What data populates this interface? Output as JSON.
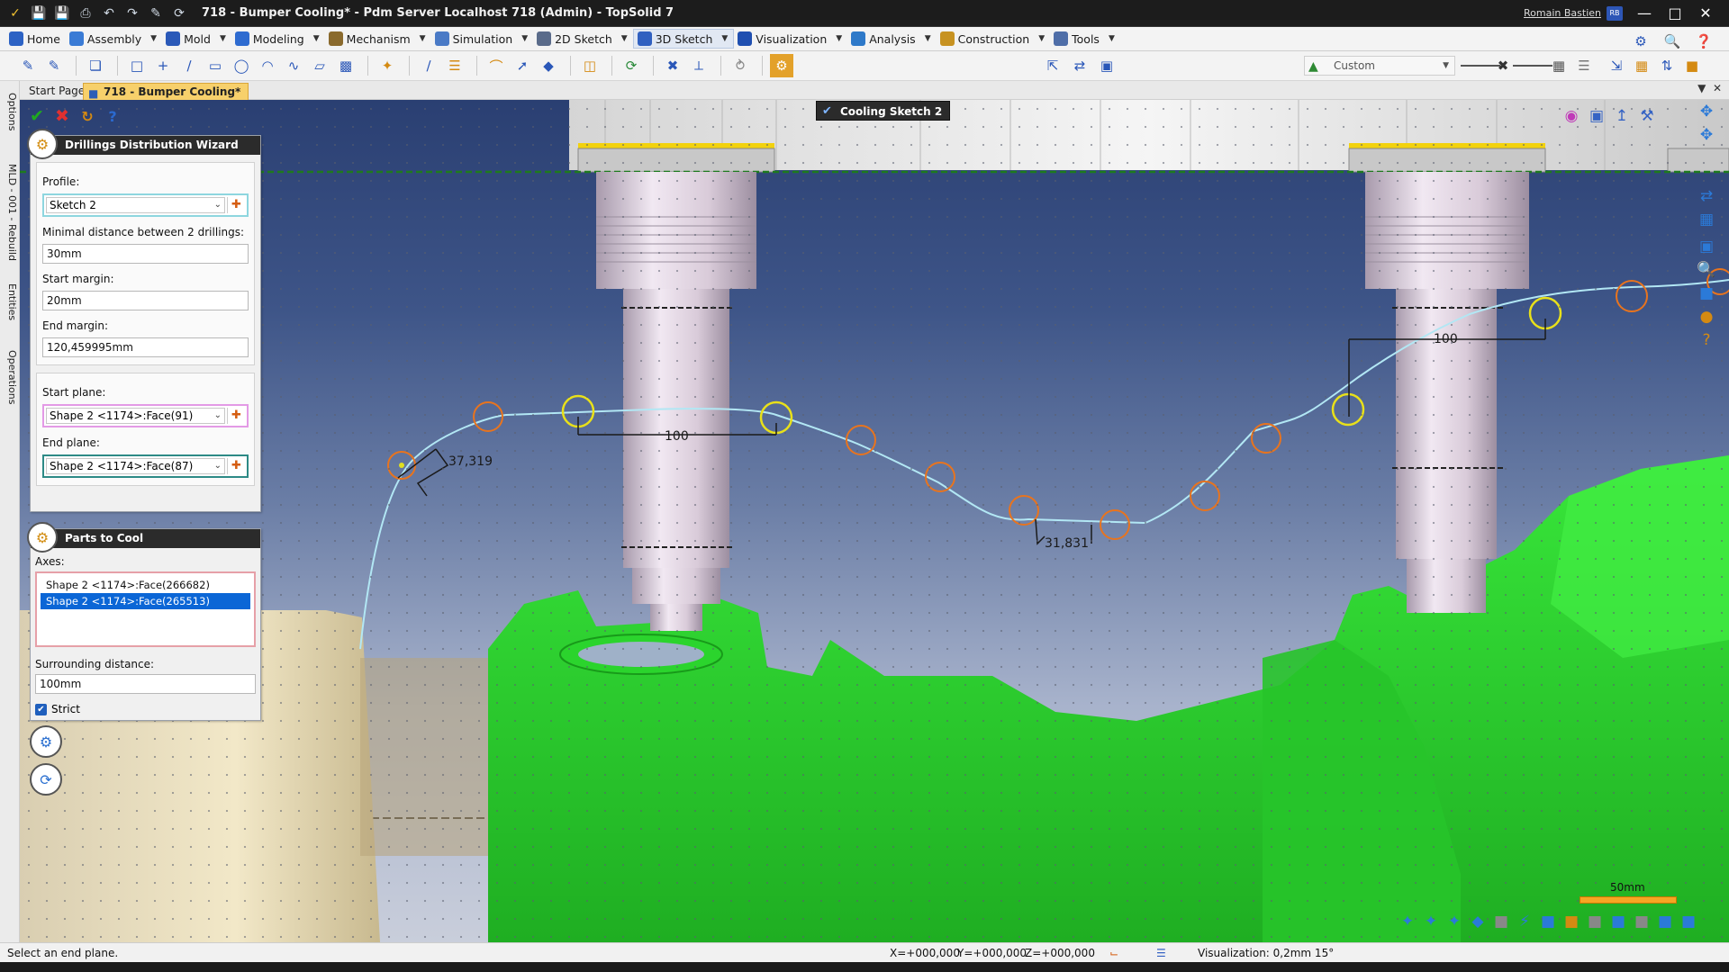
{
  "window": {
    "title": "718 - Bumper Cooling* - Pdm Server Localhost 718 (Admin) - TopSolid 7",
    "user": "Romain Bastien",
    "user_badge": "RB"
  },
  "menus": [
    {
      "label": "Home",
      "color": "#2c62c4"
    },
    {
      "label": "Assembly",
      "color": "#3a7bd5"
    },
    {
      "label": "Mold",
      "color": "#2a59b8"
    },
    {
      "label": "Modeling",
      "color": "#2e6bd0"
    },
    {
      "label": "Mechanism",
      "color": "#8a6a2d"
    },
    {
      "label": "Simulation",
      "color": "#4a7ac6"
    },
    {
      "label": "2D Sketch",
      "color": "#5a6b8a"
    },
    {
      "label": "3D Sketch",
      "color": "#3060c0"
    },
    {
      "label": "Visualization",
      "color": "#1f4fb0"
    },
    {
      "label": "Analysis",
      "color": "#2e79c9"
    },
    {
      "label": "Construction",
      "color": "#c79221"
    },
    {
      "label": "Tools",
      "color": "#4f6ea8"
    }
  ],
  "toolbar": {
    "style_combo": "Custom"
  },
  "tabs": {
    "start_page": "Start Page",
    "document": "718 - Bumper Cooling*"
  },
  "side_tabs": {
    "options": "Options",
    "rebuild": "MLD - 001 - Rebuild",
    "entities": "Entities",
    "operations": "Operations"
  },
  "viewport": {
    "sketch_label": "Cooling Sketch 2",
    "dim_37": "37,319",
    "dim_100_left": "100",
    "dim_31": "31,831",
    "dim_100_right": "100",
    "scale_label": "50mm"
  },
  "wizard": {
    "title": "Drillings Distribution Wizard",
    "profile_label": "Profile:",
    "profile_value": "Sketch 2",
    "min_distance_label": "Minimal distance between 2 drillings:",
    "min_distance_value": "30mm",
    "start_margin_label": "Start margin:",
    "start_margin_value": "20mm",
    "end_margin_label": "End margin:",
    "end_margin_value": "120,459995mm",
    "start_plane_label": "Start plane:",
    "start_plane_value": "Shape 2 <1174>:Face(91)",
    "end_plane_label": "End plane:",
    "end_plane_value": "Shape 2 <1174>:Face(87)"
  },
  "parts": {
    "title": "Parts to Cool",
    "axes_label": "Axes:",
    "axes": [
      {
        "label": "Shape 2 <1174>:Face(266682)",
        "selected": false
      },
      {
        "label": "Shape 2 <1174>:Face(265513)",
        "selected": true
      }
    ],
    "surrounding_label": "Surrounding distance:",
    "surrounding_value": "100mm",
    "strict_label": "Strict",
    "strict_checked": true
  },
  "status": {
    "message": "Select an end plane.",
    "x": "X=+000,000",
    "y": "Y=+000,000",
    "z": "Z=+000,000",
    "visualization": "Visualization: 0,2mm 15°"
  },
  "colors": {
    "part_green": "#2fd12f",
    "sketch_curve": "#a7e2f2",
    "drill_circle": "#e8741e",
    "axis_circle": "#e8e01a",
    "selection_blue": "#0b66d6"
  }
}
